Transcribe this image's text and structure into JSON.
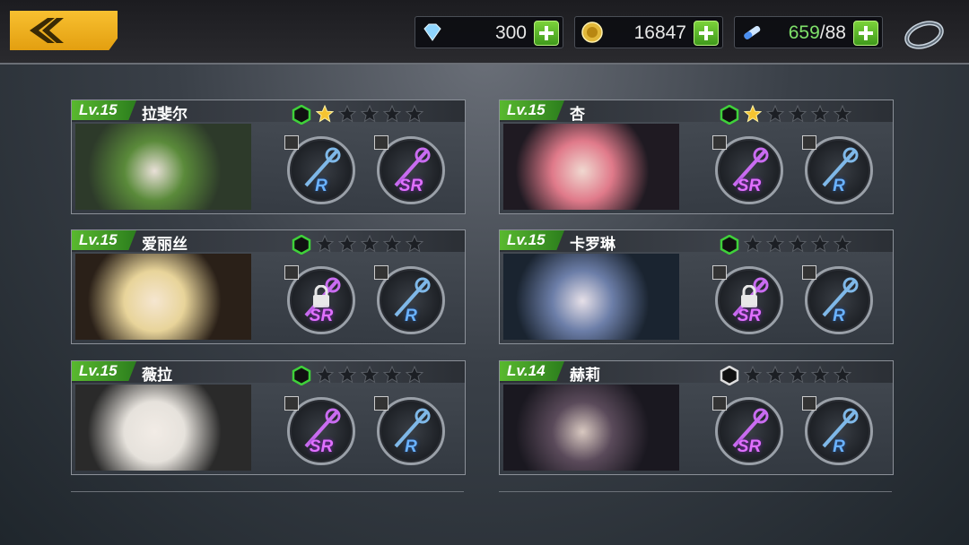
{
  "header": {
    "back_icon": "chevron-left-icon",
    "resources": [
      {
        "icon": "diamond-icon",
        "value": "300"
      },
      {
        "icon": "coin-icon",
        "value": "16847"
      },
      {
        "icon": "stamina-icon",
        "value_current": "659",
        "value_max": "/88"
      }
    ],
    "settings_icon": "ring-icon"
  },
  "characters": [
    {
      "level": "Lv.15",
      "name": "拉斐尔",
      "stars": 1,
      "hex_color": "#3fd13a",
      "weapons": [
        "R",
        "SR"
      ],
      "weapon_locked": [
        false,
        false
      ]
    },
    {
      "level": "Lv.15",
      "name": "杏",
      "stars": 1,
      "hex_color": "#3fd13a",
      "weapons": [
        "SR",
        "R"
      ],
      "weapon_locked": [
        false,
        false
      ]
    },
    {
      "level": "Lv.15",
      "name": "爱丽丝",
      "stars": 0,
      "hex_color": "#3fd13a",
      "weapons": [
        "SR",
        "R"
      ],
      "weapon_locked": [
        true,
        false
      ]
    },
    {
      "level": "Lv.15",
      "name": "卡罗琳",
      "stars": 0,
      "hex_color": "#3fd13a",
      "weapons": [
        "SR",
        "R"
      ],
      "weapon_locked": [
        true,
        false
      ]
    },
    {
      "level": "Lv.15",
      "name": "薇拉",
      "stars": 0,
      "hex_color": "#3fd13a",
      "weapons": [
        "SR",
        "R"
      ],
      "weapon_locked": [
        false,
        false
      ]
    },
    {
      "level": "Lv.14",
      "name": "赫莉",
      "stars": 0,
      "hex_color": "#dddddd",
      "weapons": [
        "SR",
        "R"
      ],
      "weapon_locked": [
        false,
        false
      ]
    }
  ],
  "colors": {
    "accent": "#f0b020",
    "level_green": "#4fae2a",
    "sr": "#e070ff",
    "r": "#6ab2ff"
  }
}
